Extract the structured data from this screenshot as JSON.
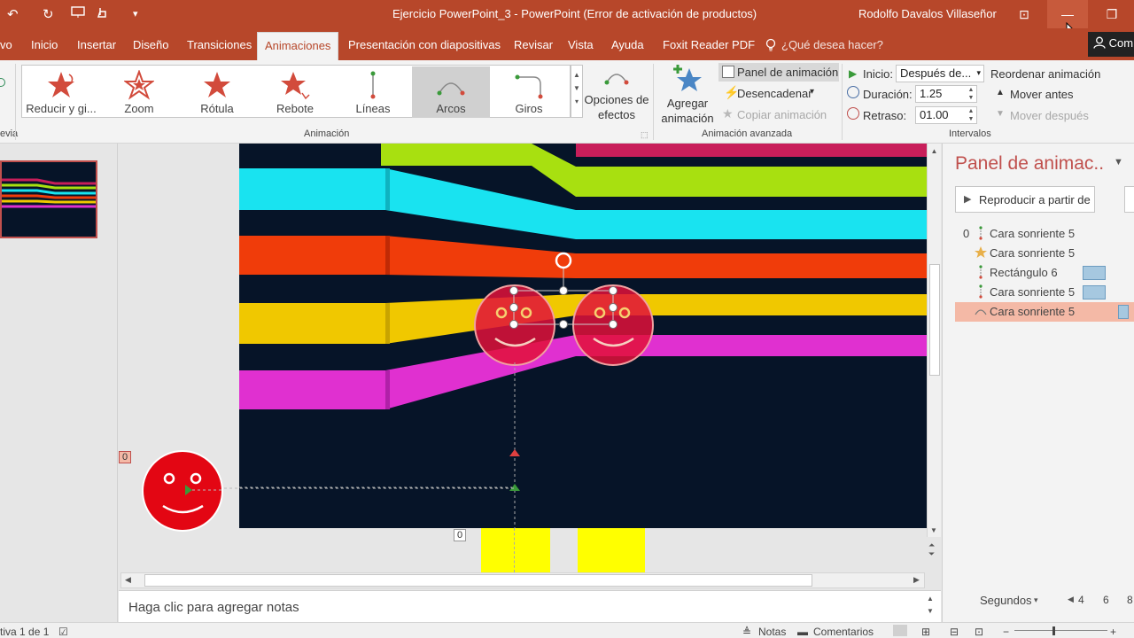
{
  "window": {
    "title": "Ejercicio PowerPoint_3  -  PowerPoint (Error de activación de productos)",
    "user": "Rodolfo Davalos Villaseñor",
    "minimize_glyph": "—",
    "restore_glyph": "❐",
    "ribbon_display_glyph": "⊡",
    "accent_color": "#b7472a"
  },
  "quick_access": {
    "undo": "↶",
    "redo": "↻",
    "dropdown": "▾"
  },
  "tabs": {
    "archivo": "vo",
    "inicio": "Inicio",
    "insertar": "Insertar",
    "diseno": "Diseño",
    "transiciones": "Transiciones",
    "animaciones": "Animaciones",
    "presentacion": "Presentación con diapositivas",
    "revisar": "Revisar",
    "vista": "Vista",
    "ayuda": "Ayuda",
    "foxit": "Foxit Reader PDF",
    "tell_me": "¿Qué desea hacer?",
    "share": "Com"
  },
  "ribbon": {
    "preview_label": "evia",
    "gallery": {
      "items": [
        "Reducir y gi...",
        "Zoom",
        "Rótula",
        "Rebote",
        "Líneas",
        "Arcos",
        "Giros"
      ],
      "selected": "Arcos"
    },
    "effect_options": [
      "Opciones de",
      "efectos"
    ],
    "group_animation": "Animación",
    "add_animation": [
      "Agregar",
      "animación"
    ],
    "animation_pane_btn": "Panel de animación",
    "trigger_btn": "Desencadenar",
    "copy_anim_btn": "Copiar animación",
    "group_advanced": "Animación avanzada",
    "inicio_label": "Inicio:",
    "inicio_value": "Después de...",
    "duracion_label": "Duración:",
    "duracion_value": "1.25",
    "retraso_label": "Retraso:",
    "retraso_value": "01.00",
    "group_timing": "Intervalos",
    "reorder_title": "Reordenar animación",
    "move_earlier": "Mover antes",
    "move_later": "Mover después"
  },
  "canvas": {
    "offslide_badge": "0",
    "below_badge": "0"
  },
  "notes": {
    "placeholder": "Haga clic para agregar notas"
  },
  "animation_pane": {
    "title": "Panel de animac..",
    "play_button": "Reproducir a partir de",
    "items": [
      {
        "num": "0",
        "icon": "line-path",
        "label": "Cara sonriente 5",
        "bar": false
      },
      {
        "num": "",
        "icon": "star",
        "label": "Cara sonriente 5",
        "bar": false
      },
      {
        "num": "",
        "icon": "line-path",
        "label": "Rectángulo 6",
        "bar": true
      },
      {
        "num": "",
        "icon": "line-path",
        "label": "Cara sonriente 5",
        "bar": true
      },
      {
        "num": "",
        "icon": "arc-path",
        "label": "Cara sonriente 5",
        "bar": true,
        "selected": true
      }
    ],
    "seconds_label": "Segundos",
    "timeline_ticks": [
      "4",
      "6",
      "8"
    ]
  },
  "status": {
    "slide_info": "tiva 1 de 1",
    "notes_btn": "Notas",
    "comments_btn": "Comentarios"
  },
  "slide_colors": [
    "#a8e010",
    "#19e3f0",
    "#f03c0a",
    "#f0c800",
    "#e030d0",
    "#c81e5a"
  ]
}
